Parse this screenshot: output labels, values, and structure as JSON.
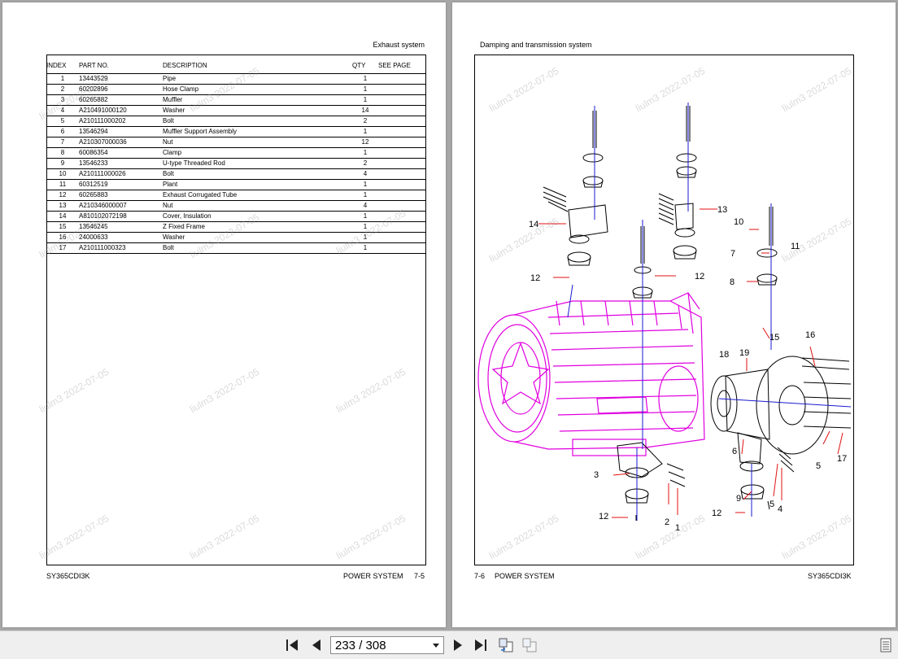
{
  "left_page": {
    "header": "Exhaust system",
    "columns": {
      "index": "INDEX",
      "part_no": "PART NO.",
      "description": "DESCRIPTION",
      "qty": "QTY",
      "see_page": "SEE PAGE"
    },
    "rows": [
      {
        "index": "1",
        "part_no": "13443529",
        "description": "Pipe",
        "qty": "1"
      },
      {
        "index": "2",
        "part_no": "60202896",
        "description": "Hose Clamp",
        "qty": "1"
      },
      {
        "index": "3",
        "part_no": "60265882",
        "description": "Muffler",
        "qty": "1"
      },
      {
        "index": "4",
        "part_no": "A210491000120",
        "description": "Washer",
        "qty": "14"
      },
      {
        "index": "5",
        "part_no": "A210111000202",
        "description": "Bolt",
        "qty": "2"
      },
      {
        "index": "6",
        "part_no": "13546294",
        "description": "Muffler Support Assembly",
        "qty": "1"
      },
      {
        "index": "7",
        "part_no": "A210307000036",
        "description": "Nut",
        "qty": "12"
      },
      {
        "index": "8",
        "part_no": "60086354",
        "description": "Clamp",
        "qty": "1"
      },
      {
        "index": "9",
        "part_no": "13546233",
        "description": "U-type Threaded Rod",
        "qty": "2"
      },
      {
        "index": "10",
        "part_no": "A210111000026",
        "description": "Bolt",
        "qty": "4"
      },
      {
        "index": "11",
        "part_no": "60312519",
        "description": "Plant",
        "qty": "1"
      },
      {
        "index": "12",
        "part_no": "60265883",
        "description": "Exhaust Corrugated Tube",
        "qty": "1"
      },
      {
        "index": "13",
        "part_no": "A210346000007",
        "description": "Nut",
        "qty": "4"
      },
      {
        "index": "14",
        "part_no": "A810102072198",
        "description": "Cover, Insulation",
        "qty": "1"
      },
      {
        "index": "15",
        "part_no": "13546245",
        "description": "Z Fixed Frame",
        "qty": "1"
      },
      {
        "index": "16",
        "part_no": "24000633",
        "description": "Washer",
        "qty": "1"
      },
      {
        "index": "17",
        "part_no": "A210111000323",
        "description": "Bolt",
        "qty": "1"
      }
    ],
    "footer_left": "SY365CDI3K",
    "footer_section": "POWER SYSTEM",
    "footer_page": "7-5"
  },
  "right_page": {
    "header": "Damping and transmission system",
    "callouts": [
      "1",
      "2",
      "3",
      "4",
      "5",
      "6",
      "7",
      "8",
      "9",
      "10",
      "11",
      "12",
      "13",
      "14",
      "15",
      "16",
      "17",
      "18",
      "19"
    ],
    "footer_page": "7-6",
    "footer_section": "POWER SYSTEM",
    "footer_right": "SY365CDI3K"
  },
  "watermark": "liulm3 2022-07-05",
  "toolbar": {
    "page_indicator": "233 / 308",
    "icons": [
      "first-page-icon",
      "prev-page-icon",
      "next-page-icon",
      "last-page-icon",
      "rotate-view-icon",
      "thumbnail-view-icon",
      "sidebar-toggle-icon"
    ]
  },
  "colors": {
    "engine": "#e000e0",
    "leader": "#e01010",
    "axis": "#1a1ad0",
    "parts": "#000000"
  }
}
